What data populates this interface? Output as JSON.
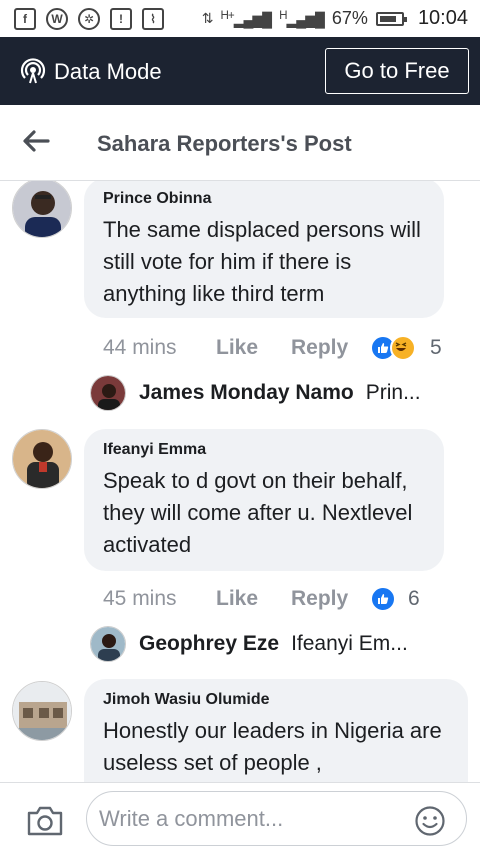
{
  "statusbar": {
    "icons": [
      "facebook-icon",
      "wordpress-icon",
      "aperture-icon",
      "sim-alert-icon",
      "activity-icon"
    ],
    "net1": "H+",
    "net2": "H",
    "battery": "67%",
    "time": "10:04"
  },
  "databar": {
    "mode_label": "Data Mode",
    "button_label": "Go to Free",
    "bg": "#1c2331"
  },
  "header": {
    "title": "Sahara Reporters's Post"
  },
  "comments": [
    {
      "author": "Prince Obinna",
      "text": "The same displaced persons will still vote for him if there is anything like third term",
      "time": "44 mins",
      "like": "Like",
      "reply": "Reply",
      "reactions": [
        "like",
        "haha"
      ],
      "reaction_count": "5",
      "reply_preview": {
        "name": "James Monday Namo",
        "snippet": "Prin..."
      }
    },
    {
      "author": "Ifeanyi Emma",
      "text": "Speak to d govt on their behalf, they will come after u. Nextlevel activated",
      "time": "45 mins",
      "like": "Like",
      "reply": "Reply",
      "reactions": [
        "like"
      ],
      "reaction_count": "6",
      "reply_preview": {
        "name": "Geophrey Eze",
        "snippet": "Ifeanyi Em..."
      }
    },
    {
      "author": "Jimoh Wasiu Olumide",
      "text": "Honestly our leaders in Nigeria are useless set of people ,"
    }
  ],
  "composer": {
    "placeholder": "Write a comment..."
  },
  "colors": {
    "accent": "#1877f2",
    "bubble": "#f0f2f5",
    "meta": "#90949c"
  }
}
